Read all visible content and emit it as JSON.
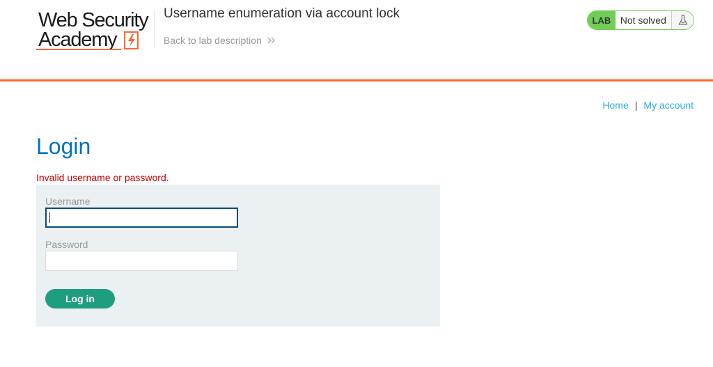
{
  "header": {
    "logo_line1": "Web Security",
    "logo_line2": "Academy",
    "lab_title": "Username enumeration via account lock",
    "back_link": "Back to lab description",
    "status": {
      "badge": "LAB",
      "text": "Not solved",
      "icon": "flask-icon"
    }
  },
  "nav": {
    "home": "Home",
    "separator": "|",
    "my_account": "My account"
  },
  "main": {
    "title": "Login",
    "error": "Invalid username or password.",
    "form": {
      "username_label": "Username",
      "username_value": "",
      "password_label": "Password",
      "password_value": "",
      "submit_label": "Log in"
    }
  },
  "colors": {
    "accent_orange": "#ff6633",
    "title_blue": "#0071bc",
    "link_blue": "#29abe2",
    "error_red": "#cc0000",
    "button_green": "#1f9e7f",
    "status_green": "#70ce56",
    "panel_bg": "#ebf0f2"
  }
}
